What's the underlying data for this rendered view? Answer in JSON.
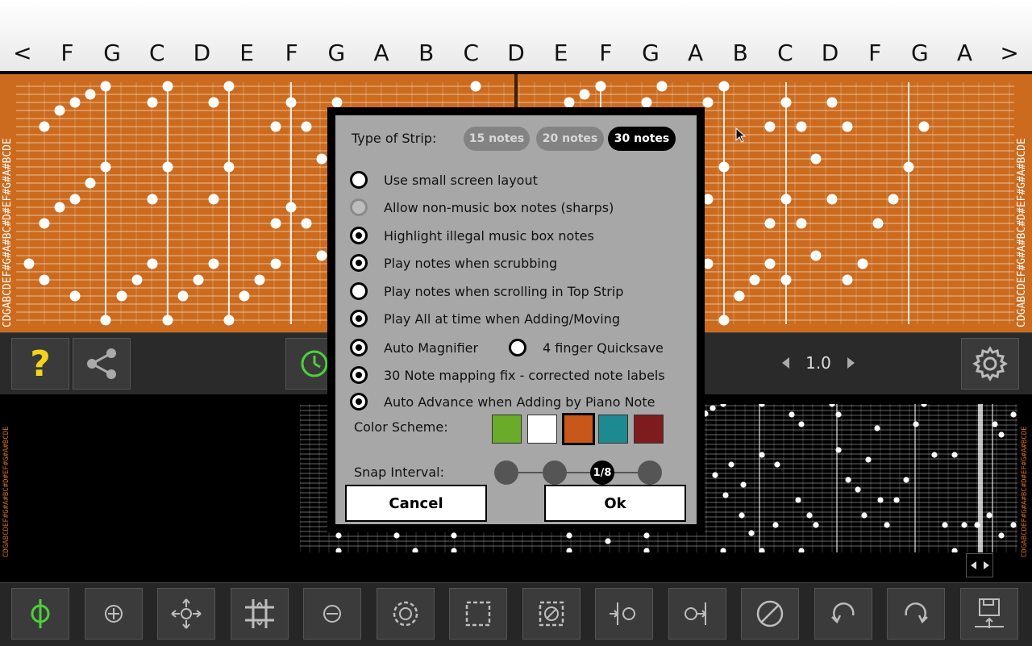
{
  "piano": {
    "keys": [
      "<",
      "F",
      "G",
      "C",
      "D",
      "E",
      "F",
      "G",
      "A",
      "B",
      "C",
      "D",
      "E",
      "F",
      "G",
      "A",
      "B",
      "C",
      "D",
      "F",
      "G",
      "A",
      ">"
    ]
  },
  "strip": {
    "left_label": "CDGABCDEF#G#A#BC#D#EF#G#A#BCDE",
    "right_label": "CDGABCDEF#G#A#BC#D#EF#G#A#BCDE"
  },
  "mid_toolbar": {
    "zoom_value": "1.0",
    "help_glyph": "?"
  },
  "dialog": {
    "type_label": "Type of Strip:",
    "strip_options": [
      "15 notes",
      "20 notes",
      "30 notes"
    ],
    "selected_strip": "30 notes",
    "options": [
      {
        "label": "Use small screen layout",
        "state": "off"
      },
      {
        "label": "Allow non-music box notes (sharps)",
        "state": "disabled"
      },
      {
        "label": "Highlight illegal music box notes",
        "state": "on"
      },
      {
        "label": "Play notes when scrubbing",
        "state": "on"
      },
      {
        "label": "Play notes when scrolling in Top Strip",
        "state": "off"
      },
      {
        "label": "Play All at time when Adding/Moving",
        "state": "on"
      },
      {
        "label": "Auto Magnifier",
        "state": "on"
      },
      {
        "label": "4 finger Quicksave",
        "state": "off"
      },
      {
        "label": "30 Note mapping fix - corrected note labels",
        "state": "on"
      },
      {
        "label": "Auto Advance when Adding by Piano Note",
        "state": "on"
      }
    ],
    "color_label": "Color Scheme:",
    "colors": [
      "#6aac2a",
      "#ffffff",
      "#c8581a",
      "#1d8990",
      "#7e1b1e"
    ],
    "selected_color": "#c8581a",
    "snap_label": "Snap Interval:",
    "snap_selected": "1/8",
    "cancel_label": "Cancel",
    "ok_label": "Ok"
  },
  "bottom_toolbar": {
    "icons": [
      "magnet-active-icon",
      "add-note-icon",
      "move-icon",
      "grid-icon",
      "remove-note-icon",
      "select-circle-icon",
      "select-box-icon",
      "deselect-icon",
      "insert-left-icon",
      "insert-right-icon",
      "no-icon",
      "undo-icon",
      "redo-icon",
      "save-icon"
    ]
  },
  "colors": {
    "strip_orange": "#cc6b1e",
    "accent_green": "#4dd13b",
    "help_yellow": "#f3d41b"
  }
}
